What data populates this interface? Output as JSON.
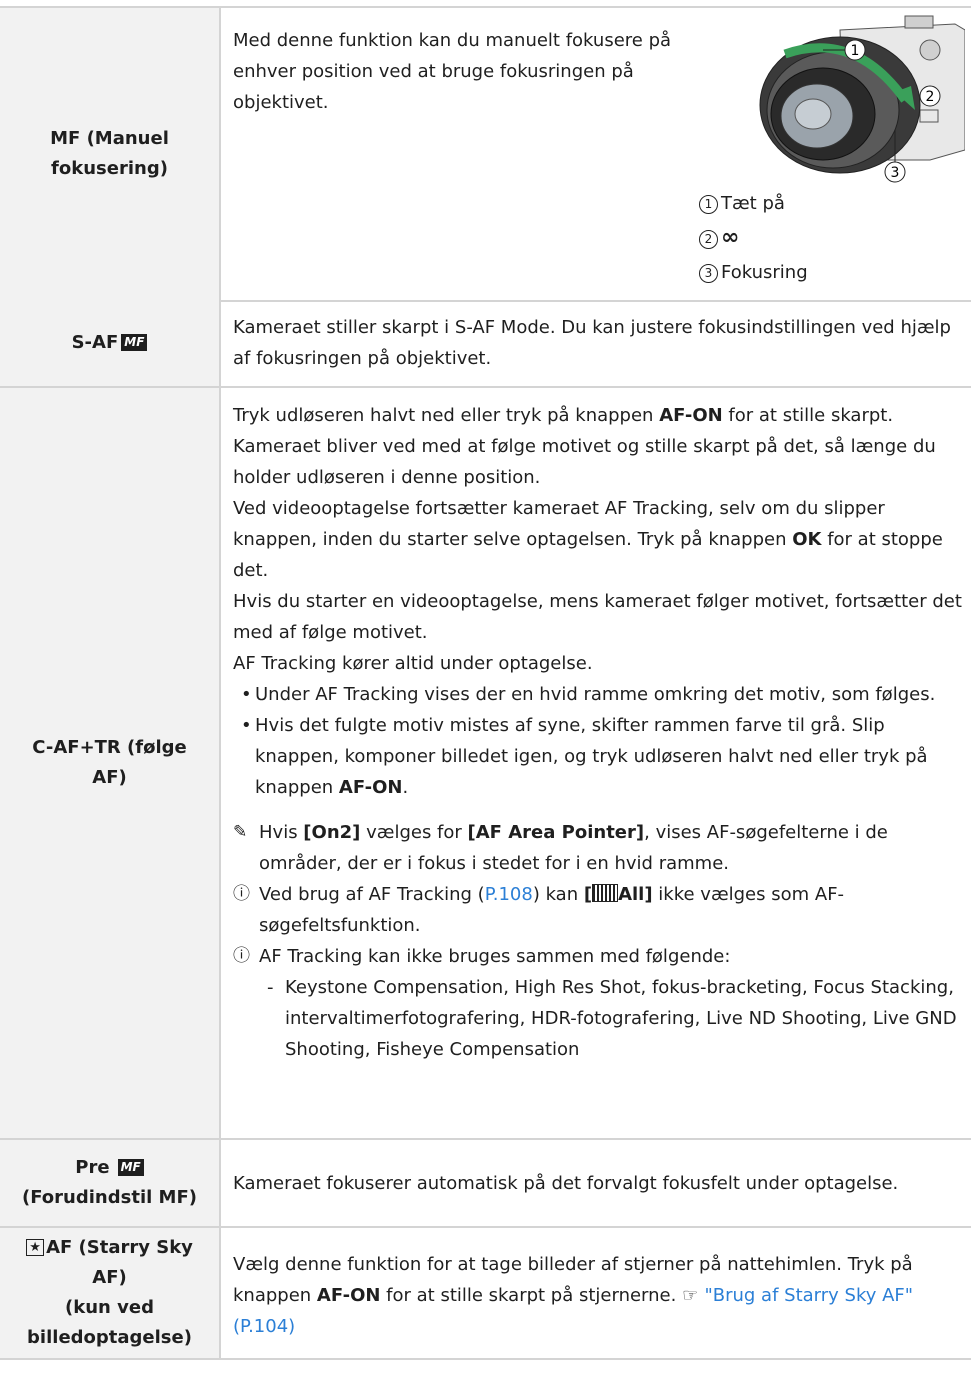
{
  "rows": {
    "mf": {
      "label": "MF (Manuel fokusering)",
      "text": "Med denne funktion kan du manuelt fokusere på enhver position ved at bruge fokusringen på objektivet.",
      "callouts": [
        "1",
        "2",
        "3"
      ],
      "legend": [
        {
          "num": "1",
          "label": "Tæt på"
        },
        {
          "num": "2",
          "label": "∞"
        },
        {
          "num": "3",
          "label": "Fokusring"
        }
      ]
    },
    "saf": {
      "label": "S-AF",
      "badge": "MF",
      "text": "Kameraet stiller skarpt i S-AF Mode. Du kan justere fokusindstillingen ved hjælp af fokusringen på objektivet."
    },
    "caf": {
      "label": "C-AF+TR (følge AF)",
      "p1a": "Tryk udløseren halvt ned eller tryk på knappen ",
      "p1b": "AF-ON",
      "p1c": " for at stille skarpt. Kameraet bliver ved med at følge motivet og stille skarpt på det, så længe du holder udløseren i denne position.",
      "p2a": "Ved videooptagelse fortsætter kameraet AF Tracking, selv om du slipper knappen, inden du starter selve optagelsen. Tryk på knappen ",
      "p2b": "OK",
      "p2c": " for at stoppe det.",
      "p3": "Hvis du starter en videooptagelse, mens kameraet følger motivet, fortsætter det med af følge motivet.",
      "p4": "AF Tracking kører altid under optagelse.",
      "b1": "Under AF Tracking vises der en hvid ramme omkring det motiv, som følges.",
      "b2a": "Hvis det fulgte motiv mistes af syne, skifter rammen farve til grå. Slip knappen, komponer billedet igen, og tryk udløseren halvt ned eller tryk på knappen ",
      "b2b": "AF-ON",
      "b2c": ".",
      "tip_a": "Hvis ",
      "tip_b": "[On2]",
      "tip_c": " vælges for ",
      "tip_d": "[AF Area Pointer]",
      "tip_e": ", vises AF-søgefelterne i de områder, der er i fokus i stedet for i en hvid ramme.",
      "n1a": "Ved brug af AF Tracking (",
      "n1link": "P.108",
      "n1b": ") kan ",
      "n1c_open": "[",
      "n1c_all": "All]",
      "n1d": " ikke vælges som AF-søgefeltsfunktion.",
      "n2": "AF Tracking kan ikke bruges sammen med følgende:",
      "n2item": "Keystone Compensation, High Res Shot, fokus-bracketing, Focus Stacking, intervaltimerfotografering, HDR-fotografering, Live ND Shooting, Live GND Shooting, Fisheye Compensation"
    },
    "pre": {
      "label_a": "Pre",
      "badge": "MF",
      "label_b": "(Forudindstil MF)",
      "text": "Kameraet fokuserer automatisk på det forvalgt fokusfelt under optagelse."
    },
    "star": {
      "label_a": "AF (Starry Sky AF)",
      "label_b": "(kun ved billedoptagelse)",
      "text_a": "Vælg denne funktion for at tage billeder af stjerner på nattehimlen. Tryk på knappen ",
      "text_b": "AF-ON",
      "text_c": " for at stille skarpt på stjernerne. ",
      "link": "\"Brug af Starry Sky AF\" (P.104)"
    }
  },
  "colors": {
    "link": "#2b7fd6",
    "header_bg": "#f2f2f2",
    "border": "#d4d4d4"
  }
}
